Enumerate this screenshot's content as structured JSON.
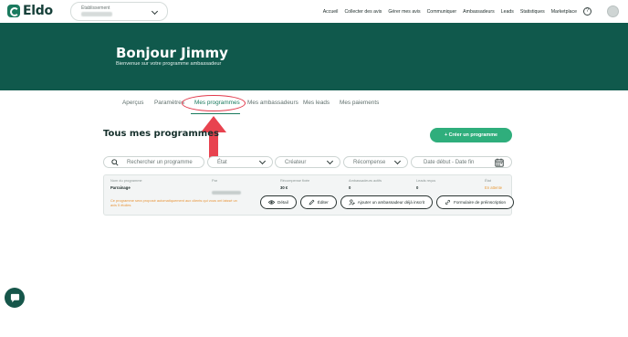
{
  "brand": {
    "name": "Eldo",
    "accent": "#1a7a5e",
    "hero_bg": "#10594c",
    "cta": "#2fae7c",
    "annotation": "#e23a4c"
  },
  "header": {
    "establishment_label": "Établissement",
    "nav": [
      "Accueil",
      "Collecter des avis",
      "Gérer mes avis",
      "Communiquer",
      "Ambassadeurs",
      "Leads",
      "Statistiques",
      "Marketplace"
    ],
    "help_icon": "question-circle-icon"
  },
  "hero": {
    "title": "Bonjour Jimmy",
    "subtitle": "Bienvenue sur votre programme ambassadeur"
  },
  "tabs": [
    "Aperçus",
    "Paramètres",
    "Mes programmes",
    "Mes ambassadeurs",
    "Mes leads",
    "Mes paiements"
  ],
  "active_tab": "Mes programmes",
  "section": {
    "title": "Tous mes programmes",
    "create_button": "+ Créer un programme"
  },
  "filters": {
    "search_placeholder": "Rechercher un programme",
    "state": "État",
    "creator": "Créateur",
    "reward": "Récompense",
    "date_range": "Date début - Date fin"
  },
  "program_card": {
    "columns": [
      {
        "label": "Nom du programme",
        "value": "Parrainage"
      },
      {
        "label": "Par",
        "value": ""
      },
      {
        "label": "Récompense fixée",
        "value": "30 €"
      },
      {
        "label": "Ambassadeurs actifs",
        "value": "0"
      },
      {
        "label": "Leads reçus",
        "value": "0"
      },
      {
        "label": "État",
        "value": "En attente"
      }
    ],
    "warning": "Ce programme sera proposé automatiquement aux clients qui vous ont laissé un avis 5 étoiles",
    "actions": [
      "Détail",
      "Éditer",
      "Ajouter un ambassadeur déjà inscrit",
      "Formulaire de préinscription"
    ]
  },
  "chat_icon": "chat-bubble-icon"
}
